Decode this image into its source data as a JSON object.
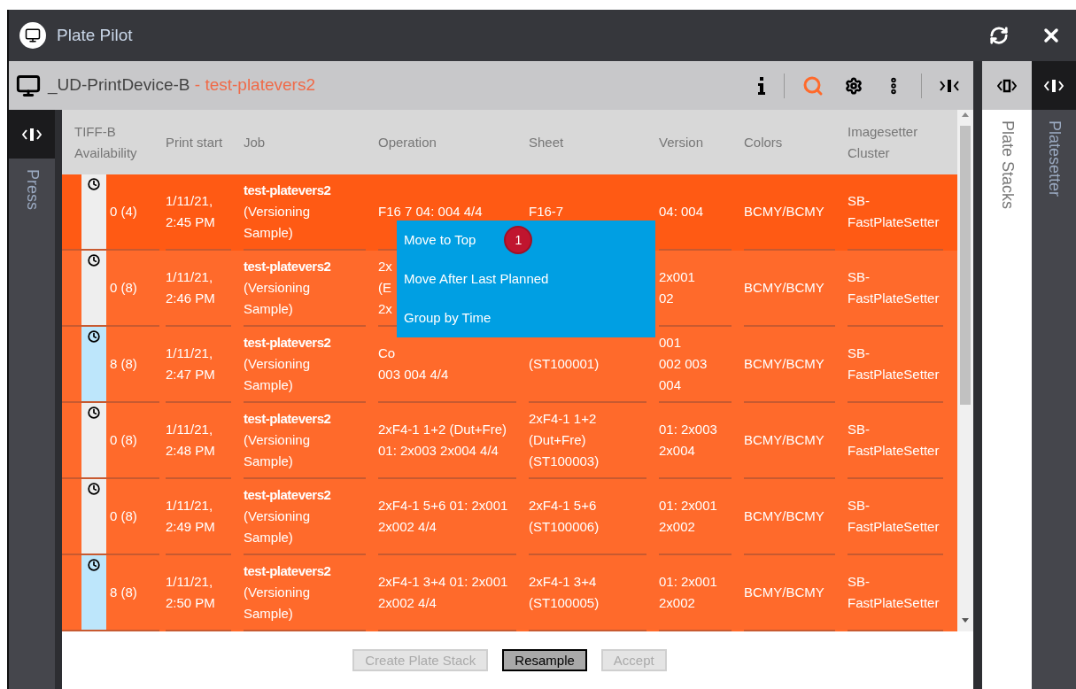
{
  "window": {
    "title": "Plate Pilot"
  },
  "toolbar": {
    "device": "_UD-PrintDevice-B",
    "separator": " - ",
    "job": "test-platevers2"
  },
  "left_panel": {
    "label": "Press"
  },
  "right_panels": [
    {
      "label": "Plate Stacks",
      "kind": "light"
    },
    {
      "label": "Platesetter",
      "kind": "dark"
    }
  ],
  "table": {
    "columns": [
      "TIFF-B Availability",
      "Print start",
      "Job",
      "Operation",
      "Sheet",
      "Version",
      "Colors",
      "Imagesetter Cluster"
    ],
    "rows": [
      {
        "selected": true,
        "availability": {
          "count": "0 (4)",
          "color": "#eeeeee"
        },
        "print_start": "1/11/21, 2:45 PM",
        "job": "test-platevers2",
        "job_note": "(Versioning Sample)",
        "operation": "F16 7 04: 004 4/4",
        "sheet": "F16-7",
        "version": "04: 004",
        "colors": "BCMY/BCMY",
        "cluster": "SB-FastPlateSetter"
      },
      {
        "selected": false,
        "availability": {
          "count": "0 (8)",
          "color": "#eeeeee"
        },
        "print_start": "1/11/21, 2:46 PM",
        "job": "test-platevers2",
        "job_note": "(Versioning Sample)",
        "operation": "2x\n(E\n2x",
        "sheet": "",
        "version": "2x001\n02",
        "colors": "BCMY/BCMY",
        "cluster": "SB-FastPlateSetter"
      },
      {
        "selected": false,
        "availability": {
          "count": "8 (8)",
          "color": "#bde6fb"
        },
        "print_start": "1/11/21, 2:47 PM",
        "job": "test-platevers2",
        "job_note": "(Versioning Sample)",
        "operation": "Co\n003 004 4/4",
        "sheet": "(ST100001)",
        "version": "001\n002 003\n004",
        "colors": "BCMY/BCMY",
        "cluster": "SB-FastPlateSetter"
      },
      {
        "selected": false,
        "availability": {
          "count": "0 (8)",
          "color": "#eeeeee"
        },
        "print_start": "1/11/21, 2:48 PM",
        "job": "test-platevers2",
        "job_note": "(Versioning Sample)",
        "operation": "2xF4-1 1+2 (Dut+Fre) 01: 2x003 2x004 4/4",
        "sheet": "2xF4-1 1+2 (Dut+Fre) (ST100003)",
        "version": "01: 2x003 2x004",
        "colors": "BCMY/BCMY",
        "cluster": "SB-FastPlateSetter"
      },
      {
        "selected": false,
        "availability": {
          "count": "0 (8)",
          "color": "#eeeeee"
        },
        "print_start": "1/11/21, 2:49 PM",
        "job": "test-platevers2",
        "job_note": "(Versioning Sample)",
        "operation": "2xF4-1 5+6 01: 2x001 2x002 4/4",
        "sheet": "2xF4-1 5+6 (ST100006)",
        "version": "01: 2x001 2x002",
        "colors": "BCMY/BCMY",
        "cluster": "SB-FastPlateSetter"
      },
      {
        "selected": false,
        "availability": {
          "count": "8 (8)",
          "color": "#bde6fb"
        },
        "print_start": "1/11/21, 2:50 PM",
        "job": "test-platevers2",
        "job_note": "(Versioning Sample)",
        "operation": "2xF4-1 3+4 01: 2x001 2x002 4/4",
        "sheet": "2xF4-1 3+4 (ST100005)",
        "version": "01: 2x001 2x002",
        "colors": "BCMY/BCMY",
        "cluster": "SB-FastPlateSetter"
      }
    ]
  },
  "context_menu": {
    "items": [
      {
        "label": "Move to Top",
        "badge": "1"
      },
      {
        "label": "Move After Last Planned"
      },
      {
        "label": "Group by Time"
      }
    ]
  },
  "buttons": [
    {
      "label": "Create Plate Stack",
      "disabled": true
    },
    {
      "label": "Resample",
      "disabled": false
    },
    {
      "label": "Accept",
      "disabled": true
    }
  ]
}
